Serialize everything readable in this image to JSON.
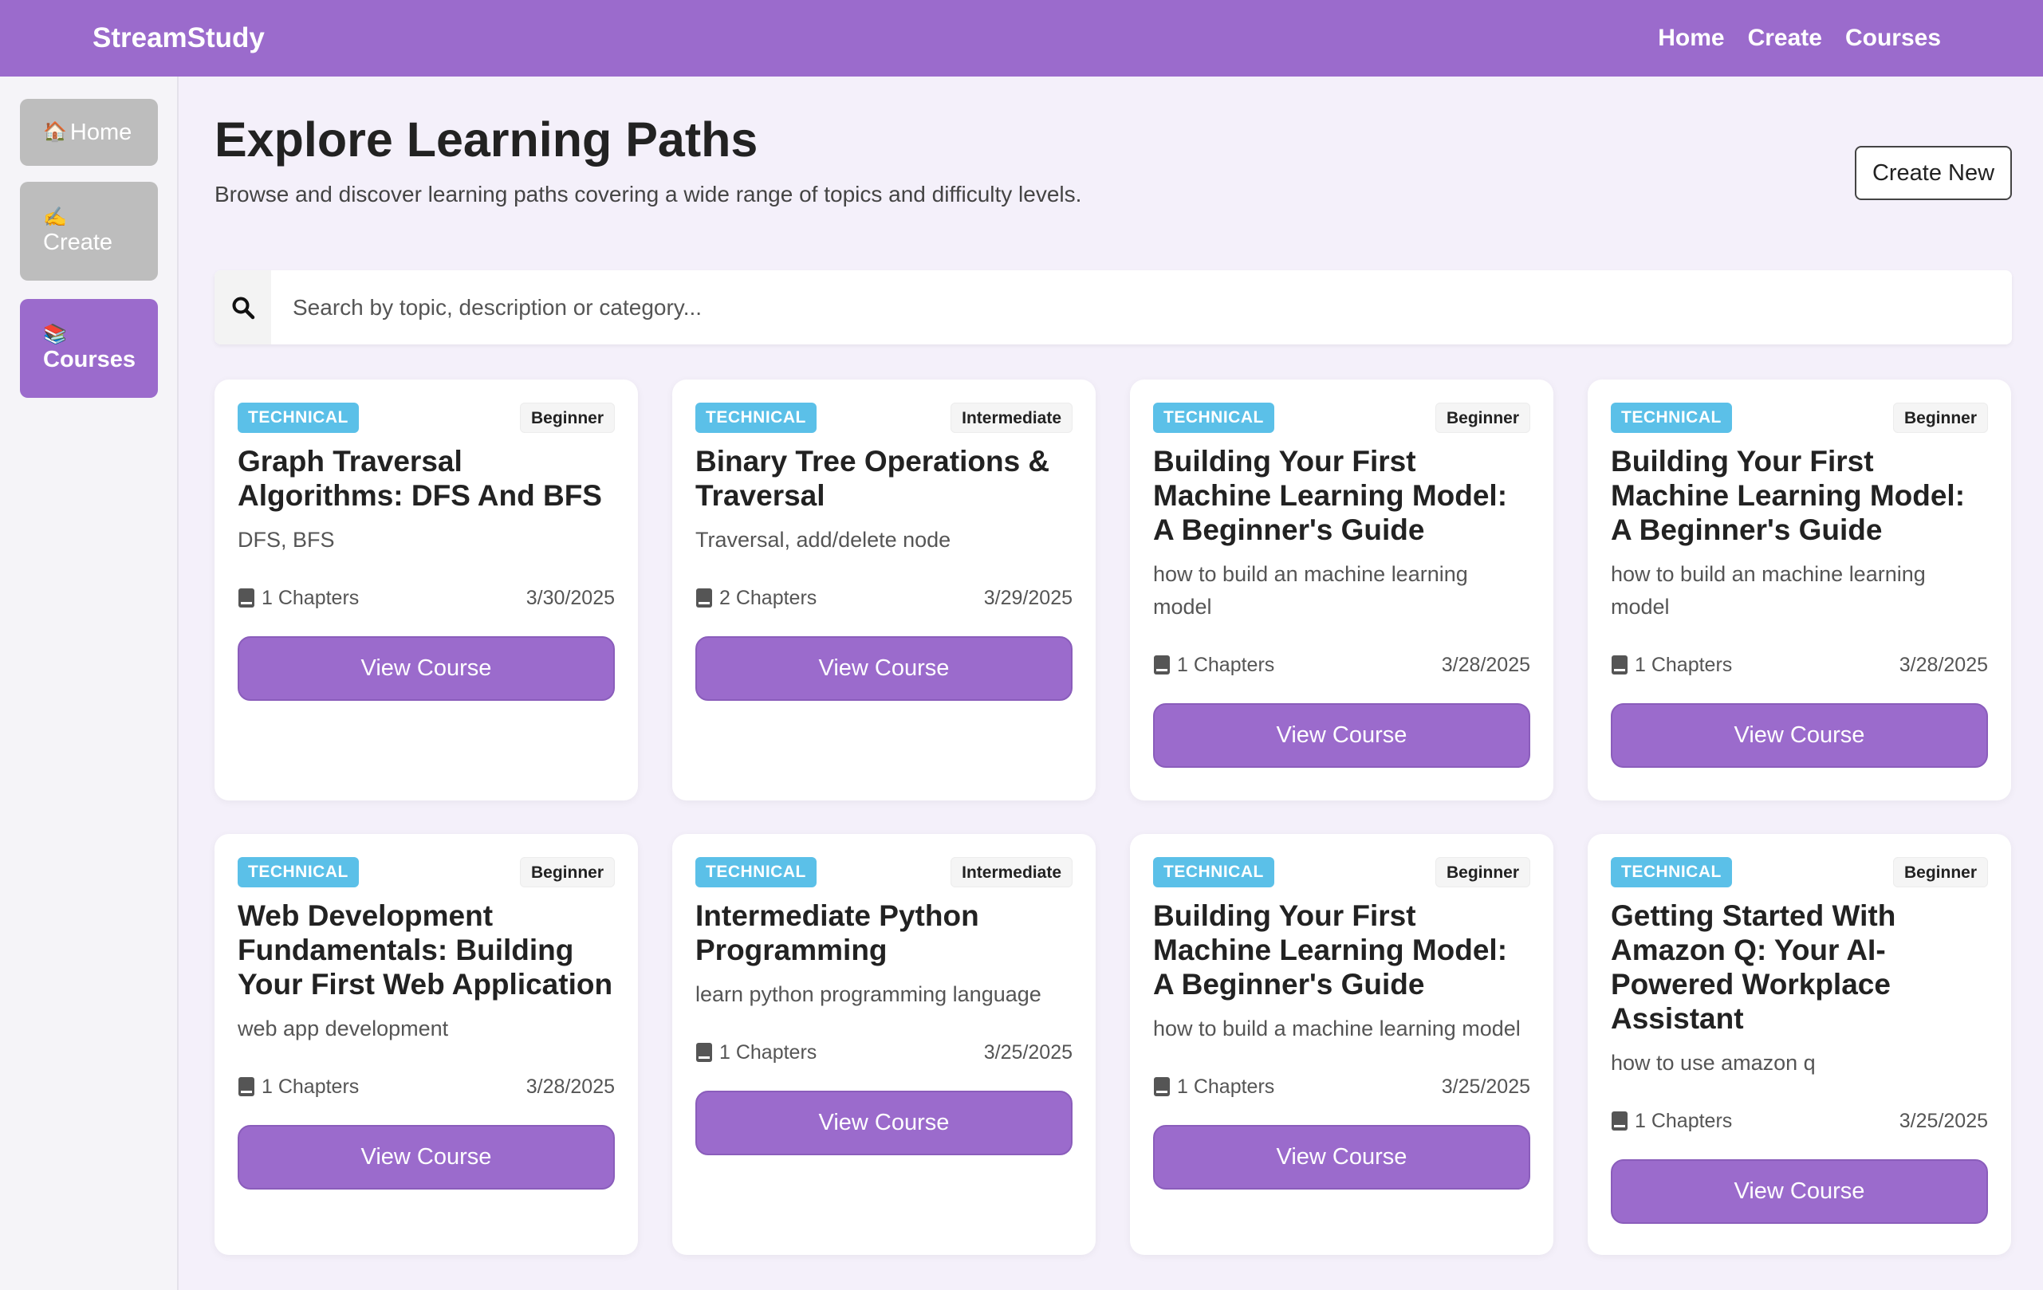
{
  "app": {
    "brand": "StreamStudy"
  },
  "topnav": [
    "Home",
    "Create",
    "Courses"
  ],
  "sidebar": {
    "items": [
      {
        "emoji": "🏠",
        "label": "Home"
      },
      {
        "emoji": "✍️",
        "label": "Create"
      },
      {
        "emoji": "📚",
        "label": "Courses"
      }
    ]
  },
  "header": {
    "title": "Explore Learning Paths",
    "subtitle": "Browse and discover learning paths covering a wide range of topics and difficulty levels.",
    "create_label": "Create New"
  },
  "search": {
    "placeholder": "Search by topic, description or category...",
    "value": ""
  },
  "courses": [
    {
      "category": "TECHNICAL",
      "level": "Beginner",
      "title": "Graph Traversal Algorithms: DFS And BFS",
      "desc": "DFS, BFS",
      "chapters": "1 Chapters",
      "date": "3/30/2025",
      "button": "View Course"
    },
    {
      "category": "TECHNICAL",
      "level": "Intermediate",
      "title": "Binary Tree Operations & Traversal",
      "desc": "Traversal, add/delete node",
      "chapters": "2 Chapters",
      "date": "3/29/2025",
      "button": "View Course"
    },
    {
      "category": "TECHNICAL",
      "level": "Beginner",
      "title": "Building Your First Machine Learning Model: A Beginner's Guide",
      "desc": "how to build an machine learning model",
      "chapters": "1 Chapters",
      "date": "3/28/2025",
      "button": "View Course"
    },
    {
      "category": "TECHNICAL",
      "level": "Beginner",
      "title": "Building Your First Machine Learning Model: A Beginner's Guide",
      "desc": "how to build an machine learning model",
      "chapters": "1 Chapters",
      "date": "3/28/2025",
      "button": "View Course"
    },
    {
      "category": "TECHNICAL",
      "level": "Beginner",
      "title": "Web Development Fundamentals: Building Your First Web Application",
      "desc": "web app development",
      "chapters": "1 Chapters",
      "date": "3/28/2025",
      "button": "View Course"
    },
    {
      "category": "TECHNICAL",
      "level": "Intermediate",
      "title": "Intermediate Python Programming",
      "desc": "learn python programming language",
      "chapters": "1 Chapters",
      "date": "3/25/2025",
      "button": "View Course"
    },
    {
      "category": "TECHNICAL",
      "level": "Beginner",
      "title": "Building Your First Machine Learning Model: A Beginner's Guide",
      "desc": "how to build a machine learning model",
      "chapters": "1 Chapters",
      "date": "3/25/2025",
      "button": "View Course"
    },
    {
      "category": "TECHNICAL",
      "level": "Beginner",
      "title": "Getting Started With Amazon Q: Your AI-Powered Workplace Assistant",
      "desc": "how to use amazon q",
      "chapters": "1 Chapters",
      "date": "3/25/2025",
      "button": "View Course"
    }
  ],
  "colors": {
    "brand": "#9b6bcc",
    "tag_technical": "#5bc0e8",
    "sidebar_inactive": "#bdbdbd",
    "page_bg": "#f4f0fa"
  }
}
